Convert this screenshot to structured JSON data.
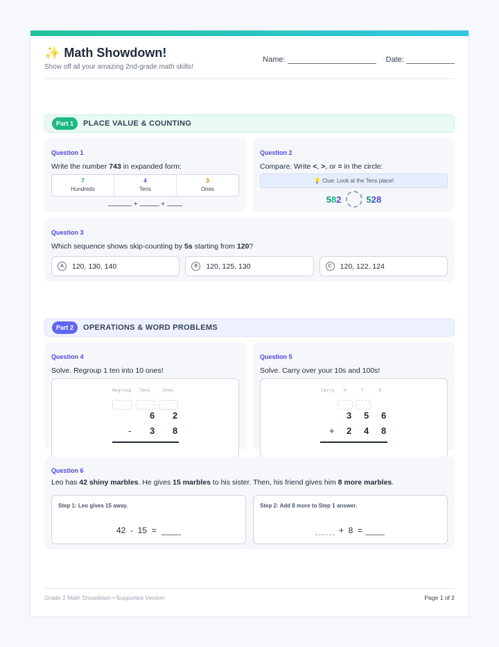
{
  "header": {
    "icon": "sparkle-icon",
    "title": "Math Showdown!",
    "subtitle": "Show off all your amazing 2nd-grade math skills!",
    "name_label": "Name:",
    "date_label": "Date:"
  },
  "part1": {
    "pill": "Part 1",
    "title": "PLACE VALUE & COUNTING",
    "color": "#1eb980"
  },
  "q1": {
    "label": "Question 1",
    "text_pre": "Write the number ",
    "number": "743",
    "text_post": " in expanded form:",
    "columns": [
      {
        "digit": "7",
        "name": "Hundreds",
        "color": "#0f9d78"
      },
      {
        "digit": "4",
        "name": "Tens",
        "color": "#4f46e5"
      },
      {
        "digit": "3",
        "name": "Ones",
        "color": "#e07b00"
      }
    ],
    "plus": "+"
  },
  "q2": {
    "label": "Question 2",
    "text_pre": "Compare. Write ",
    "sym1": "<",
    "sep1": ", ",
    "sym2": ">",
    "sep2": ", or ",
    "sym3": "=",
    "text_post": " in the circle:",
    "clue": "💡 Clue: Look at the Tens place!",
    "left_a": "5",
    "left_b": "8",
    "left_c": "2",
    "right_a": "5",
    "right_b": "2",
    "right_c": "8"
  },
  "q3": {
    "label": "Question 3",
    "text_pre": "Which sequence shows skip-counting by ",
    "by": "5s",
    "text_mid": " starting from ",
    "start": "120",
    "text_post": "?",
    "options": [
      {
        "letter": "A",
        "text": "120, 130, 140"
      },
      {
        "letter": "B",
        "text": "120, 125, 130"
      },
      {
        "letter": "C",
        "text": "120, 122, 124"
      }
    ]
  },
  "part2": {
    "pill": "Part 2",
    "title": "OPERATIONS & WORD PROBLEMS",
    "color": "#6366f1"
  },
  "q4": {
    "label": "Question 4",
    "text": "Solve. Regroup 1 ten into 10 ones!",
    "head_regroup": "Regroup",
    "head_tens": "Tens",
    "head_ones": "Ones",
    "top": [
      "6",
      "2"
    ],
    "op": "-",
    "bottom": [
      "3",
      "8"
    ]
  },
  "q5": {
    "label": "Question 5",
    "text": "Solve. Carry over your 10s and 100s!",
    "head_carry": "Carry",
    "head_h": "H",
    "head_t": "T",
    "head_o": "O",
    "top": [
      "3",
      "5",
      "6"
    ],
    "op": "+",
    "bottom": [
      "2",
      "4",
      "8"
    ]
  },
  "q6": {
    "label": "Question 6",
    "t1": "Leo has ",
    "b1": "42 shiny marbles",
    "t2": ". He gives ",
    "b2": "15 marbles",
    "t3": " to his sister. Then, his friend gives him ",
    "b3": "8 more marbles",
    "t4": ".",
    "step1_title": "Step 1: Leo gives 15 away.",
    "step1_eq": "42  -  15  =",
    "step2_title": "Step 2: Add 8 more to Step 1 answer.",
    "step2_eq": "+  8  ="
  },
  "footer": {
    "left": "Grade 2 Math Showdown • Supported Version",
    "right": "Page 1 of 2"
  }
}
